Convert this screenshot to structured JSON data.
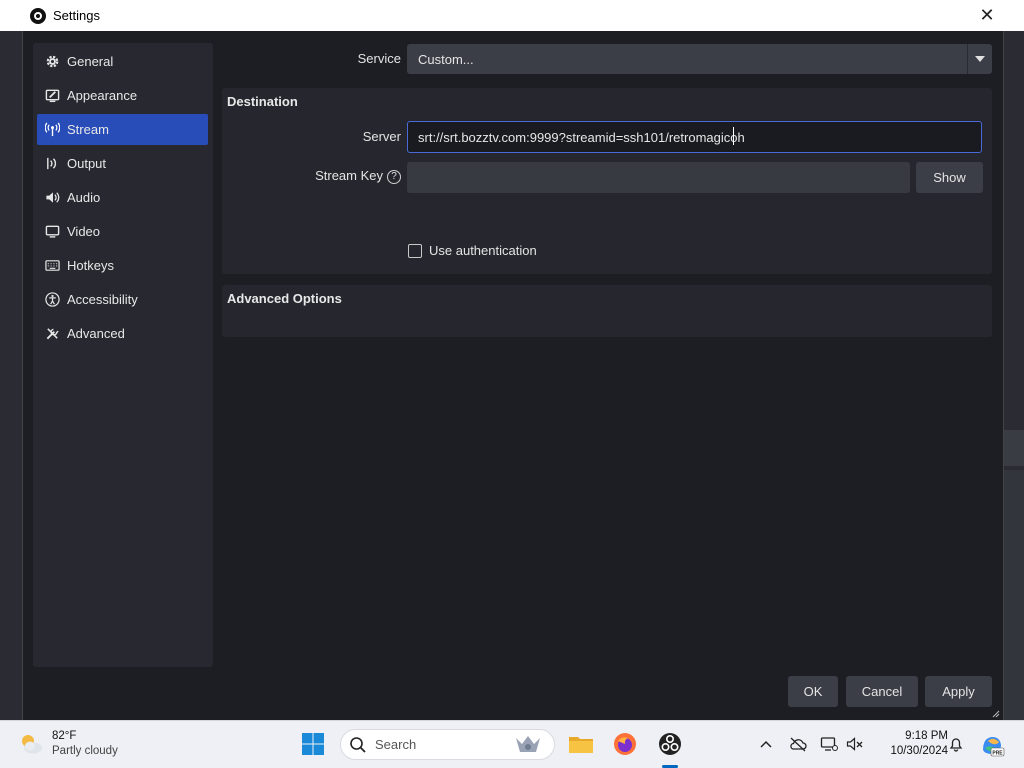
{
  "window": {
    "title": "Settings",
    "close_glyph": "✕"
  },
  "sidebar": {
    "items": [
      {
        "label": "General",
        "icon": "gear-icon"
      },
      {
        "label": "Appearance",
        "icon": "appearance-icon"
      },
      {
        "label": "Stream",
        "icon": "broadcast-icon",
        "active": true
      },
      {
        "label": "Output",
        "icon": "output-icon"
      },
      {
        "label": "Audio",
        "icon": "speaker-icon"
      },
      {
        "label": "Video",
        "icon": "monitor-icon"
      },
      {
        "label": "Hotkeys",
        "icon": "keyboard-icon"
      },
      {
        "label": "Accessibility",
        "icon": "accessibility-icon"
      },
      {
        "label": "Advanced",
        "icon": "tools-icon"
      }
    ]
  },
  "stream": {
    "service_label": "Service",
    "service_value": "Custom...",
    "destination_title": "Destination",
    "server_label": "Server",
    "server_value": "srt://srt.bozztv.com:9999?streamid=ssh101/retromagicoh",
    "stream_key_label": "Stream Key",
    "stream_key_value": "",
    "help_glyph": "?",
    "show_label": "Show",
    "use_auth_label": "Use authentication",
    "use_auth_checked": false,
    "advanced_options_title": "Advanced Options"
  },
  "footer": {
    "ok_label": "OK",
    "cancel_label": "Cancel",
    "apply_label": "Apply"
  },
  "taskbar": {
    "weather_temp": "82°F",
    "weather_condition": "Partly cloudy",
    "search_placeholder": "Search",
    "time": "9:18 PM",
    "date": "10/30/2024",
    "accent_color": "#0067c0"
  },
  "colors": {
    "active_nav": "#284cb8",
    "dialog_bg": "#1d1e24",
    "panel_bg": "#26272e"
  }
}
